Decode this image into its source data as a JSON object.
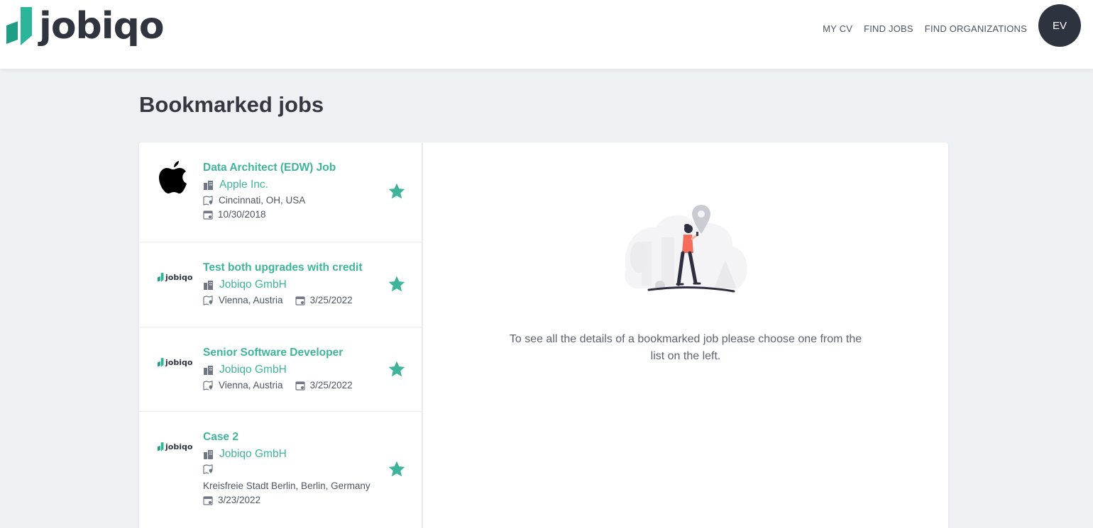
{
  "brand": {
    "name": "jobiqo",
    "accent": "#3eb59a",
    "dark": "#2e3340"
  },
  "nav": {
    "links": [
      "MY CV",
      "FIND JOBS",
      "FIND ORGANIZATIONS"
    ],
    "avatar_initials": "EV"
  },
  "page": {
    "title": "Bookmarked jobs"
  },
  "jobs": [
    {
      "title": "Data Architect (EDW) Job",
      "company": "Apple Inc.",
      "company_logo": "apple-logo",
      "location": "Cincinnati, OH, USA",
      "date": "10/30/2018",
      "bookmarked": true
    },
    {
      "title": "Test both upgrades with credit",
      "company": "Jobiqo GmbH",
      "company_logo": "jobiqo-logo",
      "location": "Vienna, Austria",
      "date": "3/25/2022",
      "bookmarked": true
    },
    {
      "title": "Senior Software Developer",
      "company": "Jobiqo GmbH",
      "company_logo": "jobiqo-logo",
      "location": "Vienna, Austria",
      "date": "3/25/2022",
      "bookmarked": true
    },
    {
      "title": "Case 2",
      "company": "Jobiqo GmbH",
      "company_logo": "jobiqo-logo",
      "location": "Kreisfreie Stadt Berlin, Berlin, Germany",
      "date": "3/23/2022",
      "bookmarked": true
    }
  ],
  "detail": {
    "empty_message": "To see all the details of a bookmarked job please choose one from the list on the left."
  }
}
